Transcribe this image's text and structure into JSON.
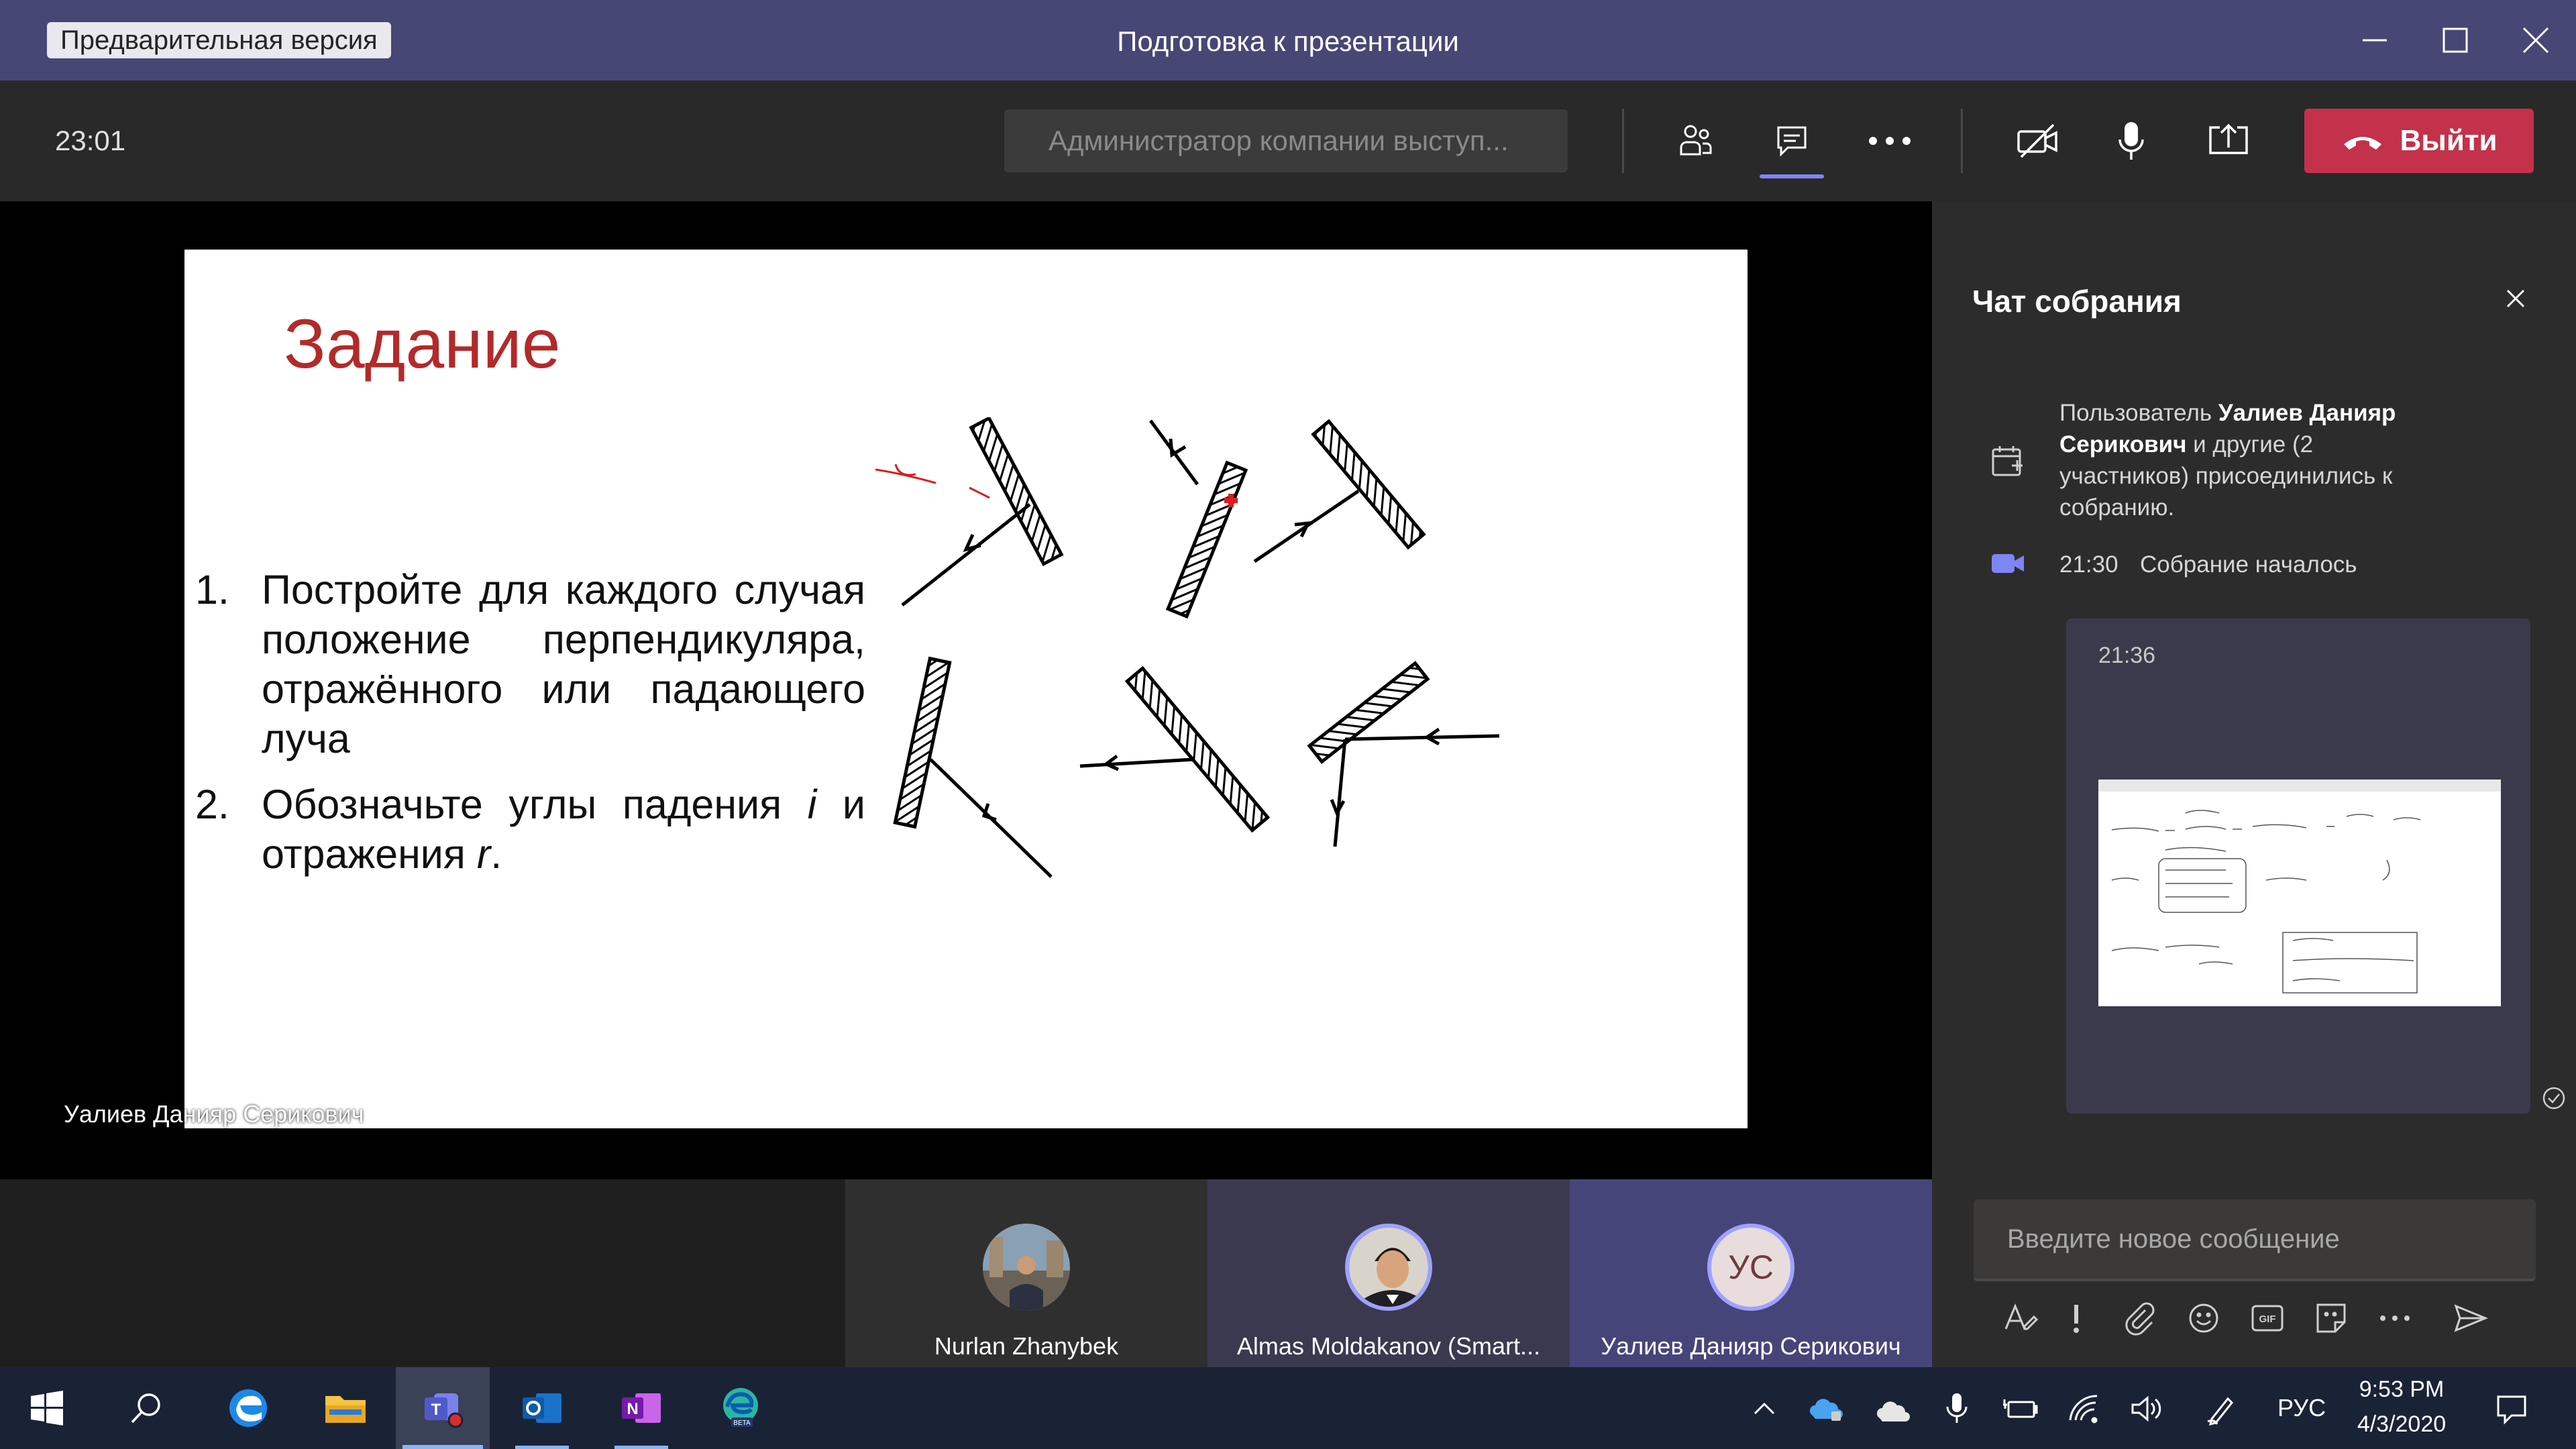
{
  "titlebar": {
    "preview_badge": "Предварительная версия",
    "title": "Подготовка к презентации"
  },
  "toolbar": {
    "elapsed_time": "23:01",
    "presenter_status": "Администратор компании выступ...",
    "leave_label": "Выйти",
    "colors": {
      "leave": "#c4314b",
      "accent": "#7f85f5"
    }
  },
  "slide": {
    "title": "Задание",
    "tasks": [
      {
        "num": "1.",
        "text": "Постройте для каждого случая положение перпендикуляра, отражённого или падающего луча"
      },
      {
        "num": "2.",
        "text_a": "Обозначьте углы падения ",
        "var_i": "i",
        "text_b": " и отражения ",
        "var_r": "r",
        "text_c": "."
      }
    ],
    "presenter_name": "Уалиев Данияр Серикович"
  },
  "participants": [
    {
      "name": "Nurlan Zhanybek"
    },
    {
      "name": "Almas Moldakanov (Smart..."
    },
    {
      "name": "Уалиев Данияр Серикович",
      "initials": "УС"
    }
  ],
  "chat": {
    "title": "Чат собрания",
    "system_message": {
      "prefix": "Пользователь ",
      "user": "Уалиев Данияр Серикович",
      "suffix": " и другие (2 участников) присоединились к собранию."
    },
    "meeting_started": {
      "time": "21:30",
      "text": "Собрание началось"
    },
    "message": {
      "time": "21:36"
    },
    "compose_placeholder": "Введите новое сообщение"
  },
  "taskbar": {
    "language": "РУС",
    "time": "9:53 PM",
    "date": "4/3/2020"
  }
}
